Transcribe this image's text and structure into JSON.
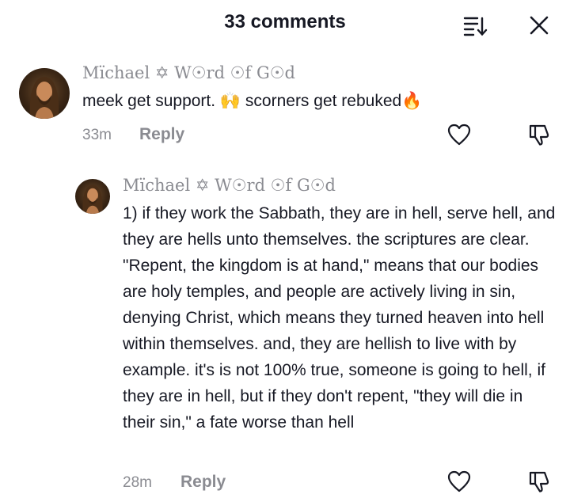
{
  "header": {
    "title": "33 comments"
  },
  "comments": [
    {
      "username": "Mïchael ✡ W☉rd ☉f G☉d",
      "text": "meek get support. 🙌 scorners get rebuked🔥",
      "time": "33m",
      "reply_label": "Reply"
    },
    {
      "username": "Mïchael ✡ W☉rd ☉f G☉d",
      "text": "1) if they work the Sabbath, they are in hell, serve hell, and they are hells unto themselves. the scriptures are clear. \"Repent, the kingdom is at hand,\" means that our bodies are holy temples, and people are actively living in sin, denying Christ, which means they turned heaven into hell within themselves. and, they are hellish to live with by example. it's is not 100% true, someone is going to hell, if they are in hell, but if they don't repent, \"they will die in their sin,\" a fate worse than hell",
      "time": "28m",
      "reply_label": "Reply"
    }
  ],
  "icons": {
    "sort": "sort-icon",
    "close": "close-icon",
    "like": "heart-icon",
    "dislike": "thumbs-down-icon"
  },
  "colors": {
    "text": "#161823",
    "muted": "#8a8b91"
  }
}
